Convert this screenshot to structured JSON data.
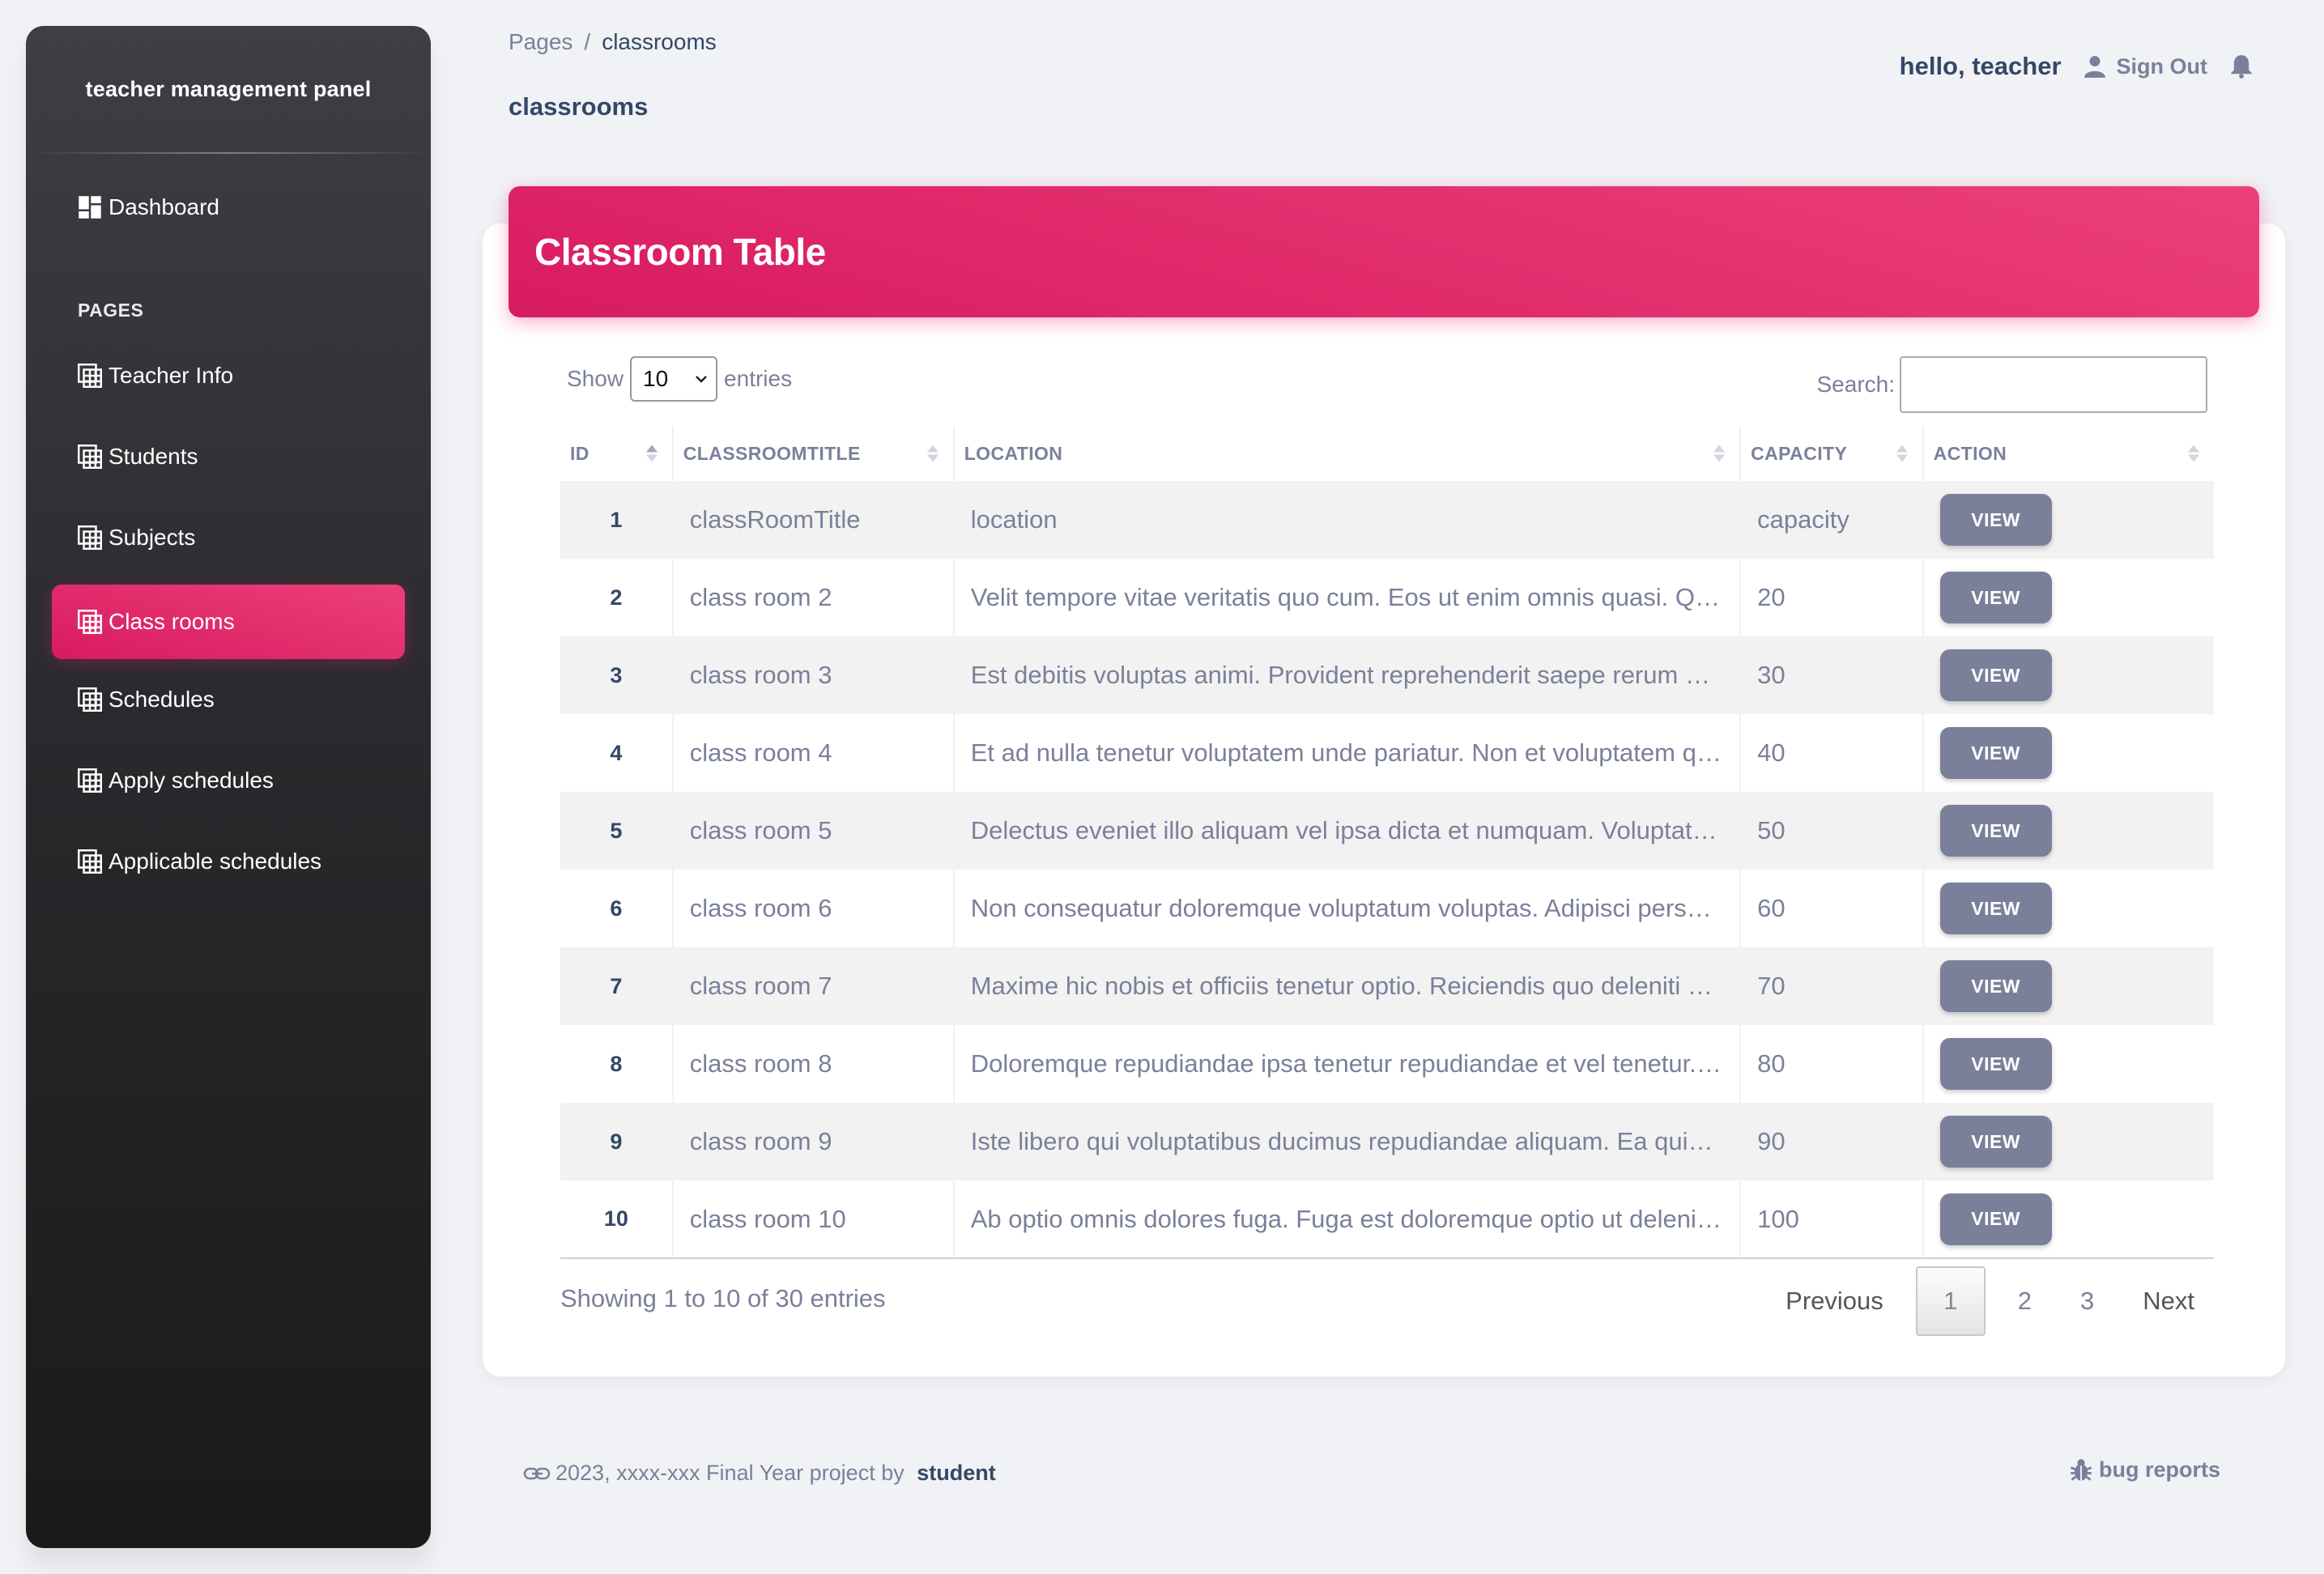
{
  "sidebar": {
    "brand": "teacher management panel",
    "dashboard_label": "Dashboard",
    "section_label": "PAGES",
    "items": [
      {
        "label": "Teacher Info",
        "icon": "table-icon"
      },
      {
        "label": "Students",
        "icon": "table-icon"
      },
      {
        "label": "Subjects",
        "icon": "table-icon"
      },
      {
        "label": "Class rooms",
        "icon": "table-icon",
        "active": true
      },
      {
        "label": "Schedules",
        "icon": "table-icon"
      },
      {
        "label": "Apply schedules",
        "icon": "table-icon"
      },
      {
        "label": "Applicable schedules",
        "icon": "table-icon"
      }
    ]
  },
  "header": {
    "breadcrumb_root": "Pages",
    "breadcrumb_sep": "/",
    "breadcrumb_current": "classrooms",
    "page_title": "classrooms",
    "greeting": "hello, teacher",
    "sign_out": "Sign Out"
  },
  "card": {
    "title": "Classroom Table",
    "show_label": "Show",
    "entries_value": "10",
    "entries_label": "entries",
    "search_label": "Search:",
    "search_value": ""
  },
  "table": {
    "columns": [
      "ID",
      "CLASSROOMTITLE",
      "LOCATION",
      "CAPACITY",
      "ACTION"
    ],
    "rows": [
      {
        "id": "1",
        "title": "classRoomTitle",
        "location": "location",
        "capacity": "capacity",
        "action": "VIEW"
      },
      {
        "id": "2",
        "title": "class room 2",
        "location": "Velit tempore vitae veritatis quo cum. Eos ut enim omnis quasi. Qui qui dolor...",
        "capacity": "20",
        "action": "VIEW"
      },
      {
        "id": "3",
        "title": "class room 3",
        "location": "Est debitis voluptas animi. Provident reprehenderit saepe rerum ut ut hic. No...",
        "capacity": "30",
        "action": "VIEW"
      },
      {
        "id": "4",
        "title": "class room 4",
        "location": "Et ad nulla tenetur voluptatem unde pariatur. Non et voluptatem qui et tempor...",
        "capacity": "40",
        "action": "VIEW"
      },
      {
        "id": "5",
        "title": "class room 5",
        "location": "Delectus eveniet illo aliquam vel ipsa dicta et numquam. Voluptate et id cons...",
        "capacity": "50",
        "action": "VIEW"
      },
      {
        "id": "6",
        "title": "class room 6",
        "location": "Non consequatur doloremque voluptatum voluptas. Adipisci perspiciatis sunt et...",
        "capacity": "60",
        "action": "VIEW"
      },
      {
        "id": "7",
        "title": "class room 7",
        "location": "Maxime hic nobis et officiis tenetur optio. Reiciendis quo deleniti esse volu...",
        "capacity": "70",
        "action": "VIEW"
      },
      {
        "id": "8",
        "title": "class room 8",
        "location": "Doloremque repudiandae ipsa tenetur repudiandae et vel tenetur. Ab animi dolo...",
        "capacity": "80",
        "action": "VIEW"
      },
      {
        "id": "9",
        "title": "class room 9",
        "location": "Iste libero qui voluptatibus ducimus repudiandae aliquam. Ea quia quam esse n...",
        "capacity": "90",
        "action": "VIEW"
      },
      {
        "id": "10",
        "title": "class room 10",
        "location": "Ab optio omnis dolores fuga. Fuga est doloremque optio ut deleniti culpa inci...",
        "capacity": "100",
        "action": "VIEW"
      }
    ]
  },
  "pagination": {
    "info": "Showing 1 to 10 of 30 entries",
    "previous": "Previous",
    "pages": [
      "1",
      "2",
      "3"
    ],
    "current": "1",
    "next": "Next"
  },
  "footer": {
    "text": "2023, xxxx-xxx Final Year project by",
    "author": "student",
    "bug_reports": "bug reports"
  },
  "colors": {
    "accent": "#e91e63",
    "sidebar_dark": "#1a1a1a",
    "muted": "#7b809a",
    "text": "#344767"
  }
}
